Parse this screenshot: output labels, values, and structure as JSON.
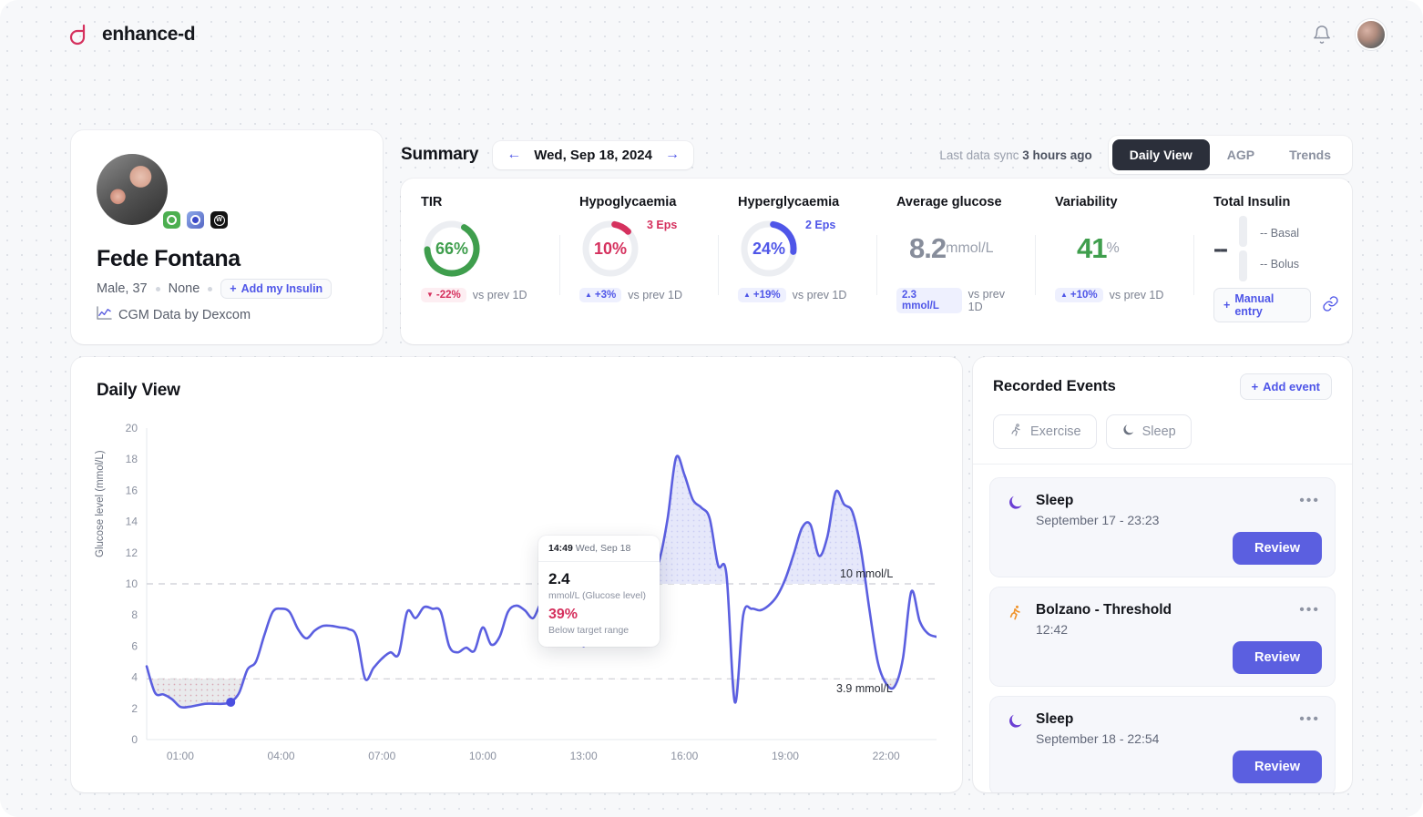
{
  "app": {
    "brand": "enhance-d",
    "bell_icon": "bell-icon",
    "avatar_icon": "user-avatar"
  },
  "profile": {
    "name": "Fede Fontana",
    "sex_age": "Male, 37",
    "condition": "None",
    "add_insulin_label": "Add my Insulin",
    "cgm_text": "CGM Data by Dexcom",
    "badges": [
      "omnipod-badge",
      "dexcom-clarity-badge",
      "whoop-badge"
    ]
  },
  "summary": {
    "title": "Summary",
    "date": "Wed, Sep 18, 2024",
    "prev_icon": "arrow-left-icon",
    "next_icon": "arrow-right-icon",
    "sync_prefix": "Last data sync",
    "sync_value": "3 hours ago",
    "tabs": [
      {
        "label": "Daily View",
        "active": true
      },
      {
        "label": "AGP",
        "active": false
      },
      {
        "label": "Trends",
        "active": false
      }
    ]
  },
  "metrics": [
    {
      "label": "TIR",
      "value": "66%",
      "ring_pct": 66,
      "color": "#3f9e4d",
      "delta": "-22%",
      "delta_dir": "down",
      "delta_suffix": "vs prev 1D"
    },
    {
      "label": "Hypoglycaemia",
      "value": "10%",
      "ring_pct": 10,
      "color": "#d5315e",
      "eps": "3 Eps",
      "delta": "+3%",
      "delta_dir": "up",
      "delta_suffix": "vs prev 1D"
    },
    {
      "label": "Hyperglycaemia",
      "value": "24%",
      "ring_pct": 24,
      "color": "#4f56e8",
      "eps": "2 Eps",
      "delta": "+19%",
      "delta_dir": "up",
      "delta_suffix": "vs prev 1D"
    }
  ],
  "avg_glucose": {
    "label": "Average glucose",
    "value": "8.2",
    "unit": "mmol/L",
    "delta": "2.3 mmol/L",
    "delta_suffix": "vs prev 1D"
  },
  "variability": {
    "label": "Variability",
    "value": "41",
    "unit": "%",
    "delta": "+10%",
    "delta_suffix": "vs prev 1D"
  },
  "insulin": {
    "label": "Total Insulin",
    "value": "--",
    "basal": "-- Basal",
    "bolus": "-- Bolus",
    "manual_entry_label": "Manual entry",
    "link_icon": "link-icon"
  },
  "daily_view": {
    "title": "Daily View"
  },
  "tooltip": {
    "time": "14:49",
    "date": "Wed, Sep 18",
    "value": "2.4",
    "unit": "mmol/L (Glucose level)",
    "percent": "39%",
    "note": "Below target range"
  },
  "events": {
    "title": "Recorded Events",
    "add_label": "Add event",
    "filters": [
      {
        "label": "Exercise",
        "icon": "running-icon"
      },
      {
        "label": "Sleep",
        "icon": "moon-icon"
      }
    ],
    "items": [
      {
        "name": "Sleep",
        "time": "September 17 - 23:23",
        "icon": "moon-icon",
        "review_label": "Review",
        "menu_label": "•••"
      },
      {
        "name": "Bolzano - Threshold",
        "time": "12:42",
        "icon": "running-icon",
        "review_label": "Review",
        "menu_label": "•••"
      },
      {
        "name": "Sleep",
        "time": "September 18 - 22:54",
        "icon": "moon-icon",
        "review_label": "Review",
        "menu_label": "•••"
      }
    ]
  },
  "chart_data": {
    "type": "line",
    "title": "Daily View",
    "xlabel": "",
    "ylabel": "Glucose level (mmol/L)",
    "ylim": [
      0,
      20
    ],
    "yticks": [
      0,
      2,
      4,
      6,
      8,
      10,
      12,
      14,
      16,
      18,
      20
    ],
    "xticks": [
      "01:00",
      "04:00",
      "07:00",
      "10:00",
      "13:00",
      "16:00",
      "19:00",
      "22:00"
    ],
    "grid": false,
    "line_color": "#5b5fe0",
    "target_low": 3.9,
    "target_high": 10,
    "target_low_label": "3.9 mmol/L",
    "target_high_label": "10 mmol/L",
    "series": [
      {
        "name": "Glucose level",
        "unit": "mmol/L",
        "x": [
          "00:00",
          "00:15",
          "00:30",
          "00:45",
          "01:00",
          "01:15",
          "01:30",
          "01:45",
          "02:00",
          "02:15",
          "02:30",
          "02:45",
          "03:00",
          "03:15",
          "03:30",
          "03:45",
          "04:00",
          "04:15",
          "04:30",
          "04:45",
          "05:00",
          "05:15",
          "05:30",
          "05:45",
          "06:00",
          "06:15",
          "06:30",
          "06:45",
          "07:00",
          "07:15",
          "07:30",
          "07:45",
          "08:00",
          "08:15",
          "08:30",
          "08:45",
          "09:00",
          "09:15",
          "09:30",
          "09:45",
          "10:00",
          "10:15",
          "10:30",
          "10:45",
          "11:00",
          "11:15",
          "11:30",
          "11:45",
          "12:00",
          "12:15",
          "12:30",
          "12:45",
          "13:00",
          "13:15",
          "13:30",
          "13:45",
          "14:00",
          "14:15",
          "14:30",
          "14:45",
          "15:00",
          "15:15",
          "15:30",
          "15:45",
          "16:00",
          "16:15",
          "16:30",
          "16:45",
          "17:00",
          "17:15",
          "17:30",
          "17:45",
          "18:00",
          "18:15",
          "18:30",
          "18:45",
          "19:00",
          "19:15",
          "19:30",
          "19:45",
          "20:00",
          "20:15",
          "20:30",
          "20:45",
          "21:00",
          "21:15",
          "21:30",
          "21:45",
          "22:00",
          "22:15",
          "22:30",
          "22:45",
          "23:00",
          "23:15",
          "23:30"
        ],
        "values": [
          4.7,
          3.0,
          2.9,
          2.6,
          2.1,
          2.1,
          2.2,
          2.3,
          2.3,
          2.3,
          2.4,
          3.0,
          4.5,
          5.0,
          6.7,
          8.2,
          8.4,
          8.2,
          7.1,
          6.5,
          7.0,
          7.3,
          7.3,
          7.2,
          7.1,
          6.6,
          3.9,
          4.6,
          5.2,
          5.6,
          5.5,
          8.2,
          7.8,
          8.5,
          8.4,
          8.2,
          6.0,
          5.6,
          5.9,
          5.7,
          7.2,
          6.1,
          6.6,
          8.2,
          8.6,
          8.3,
          7.8,
          8.8,
          8.4,
          7.3,
          7.0,
          7.6,
          6.0,
          7.6,
          8.2,
          9.1,
          9.4,
          9.8,
          9.4,
          10.0,
          10.6,
          11.5,
          14.2,
          18.1,
          17.0,
          15.4,
          14.9,
          14.2,
          11.2,
          10.6,
          2.4,
          8.0,
          8.4,
          8.3,
          8.6,
          9.2,
          10.3,
          11.9,
          13.6,
          13.8,
          11.8,
          13.0,
          15.9,
          15.1,
          14.6,
          12.2,
          8.4,
          5.0,
          3.6,
          3.4,
          5.2,
          9.5,
          7.6,
          6.8,
          6.6
        ],
        "highlight_point": {
          "x": "14:49",
          "value": 2.4
        }
      }
    ]
  }
}
